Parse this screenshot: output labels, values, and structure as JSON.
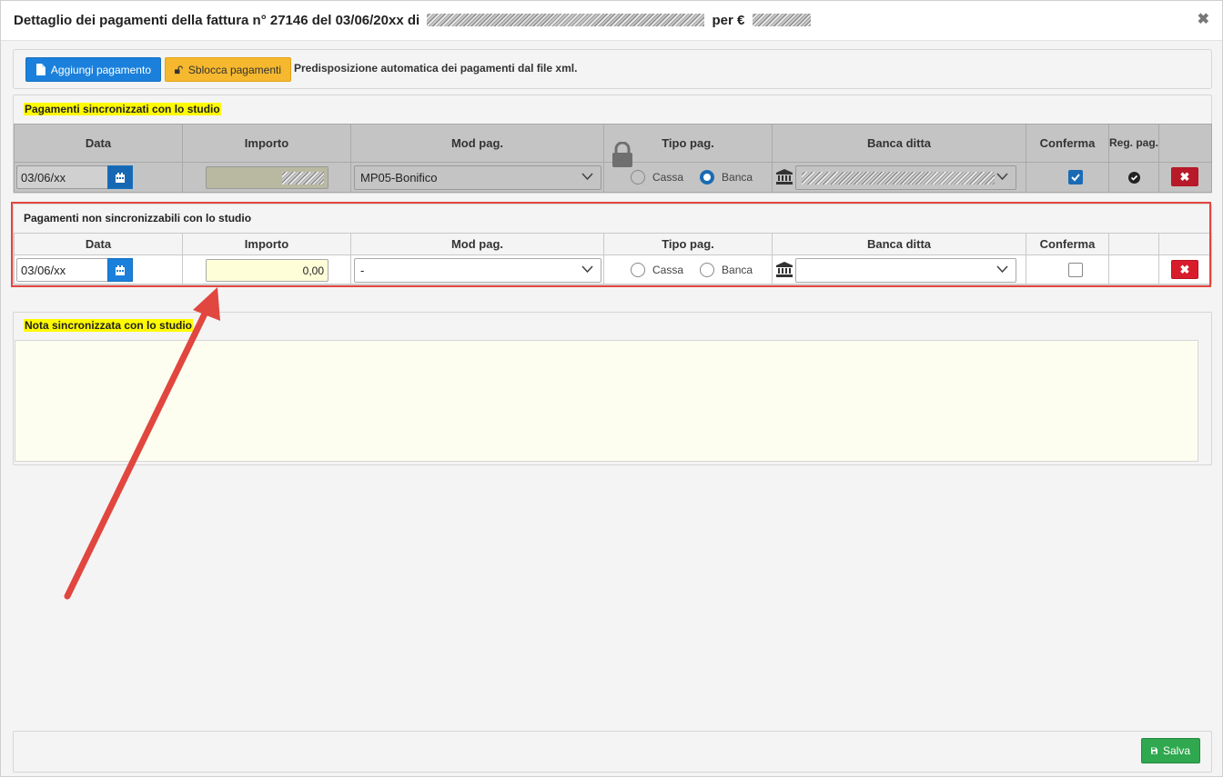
{
  "header": {
    "title_prefix": "Dettaglio dei pagamenti della fattura n° 27146 del 03/06/20xx di",
    "title_mid": "per €",
    "close_glyph": "✖"
  },
  "toolbar": {
    "add_label": "Aggiungi pagamento",
    "unlock_label": "Sblocca pagamenti",
    "info_text": "Predisposizione automatica dei pagamenti dal file xml."
  },
  "sync_section": {
    "title": "Pagamenti sincronizzati con lo studio",
    "columns": [
      "Data",
      "Importo",
      "Mod pag.",
      "Tipo pag.",
      "Banca ditta",
      "Conferma",
      "Reg. pag."
    ],
    "row": {
      "date": "03/06/xx",
      "mod_pag": "MP05-Bonifico",
      "tipo_cassa": "Cassa",
      "tipo_banca": "Banca",
      "selected_tipo": "Banca",
      "confirmed": true,
      "registered": true
    }
  },
  "nonsync_section": {
    "title": "Pagamenti non sincronizzabili con lo studio",
    "columns": [
      "Data",
      "Importo",
      "Mod pag.",
      "Tipo pag.",
      "Banca ditta",
      "Conferma"
    ],
    "row": {
      "date": "03/06/xx",
      "importo": "0,00",
      "mod_pag": "-",
      "tipo_cassa": "Cassa",
      "tipo_banca": "Banca",
      "selected_tipo": "",
      "banca": "",
      "confirmed": false
    }
  },
  "note_section": {
    "title": "Nota sincronizzata con lo studio",
    "value": ""
  },
  "footer": {
    "save_label": "Salva"
  },
  "colors": {
    "primary": "#1a80db",
    "warning": "#f5b82e",
    "success": "#2fa84f",
    "danger": "#d91c2b",
    "highlight": "#fffa00",
    "annotation": "#e1463f"
  }
}
